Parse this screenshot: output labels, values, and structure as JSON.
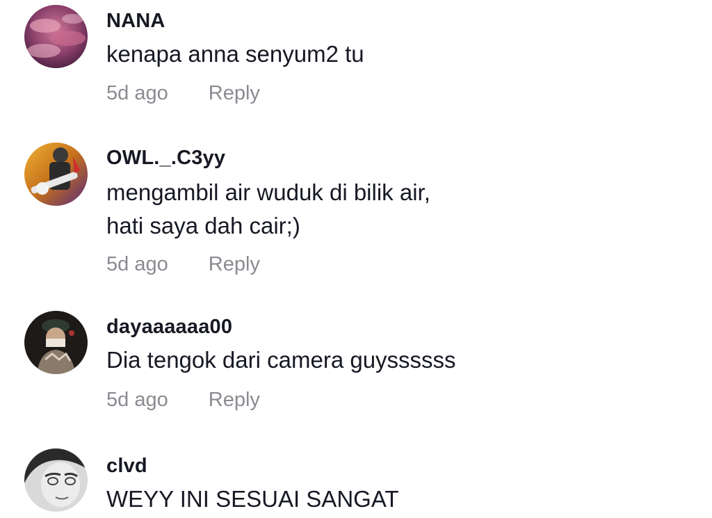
{
  "comments": [
    {
      "username": "NANA",
      "text_lines": [
        "kenapa anna senyum2 tu"
      ],
      "time": "5d ago",
      "reply_label": "Reply",
      "avatar_icon": "avatar-clouds-icon"
    },
    {
      "username": "OWL._.C3yy",
      "text_lines": [
        "mengambil air wuduk di bilik air,",
        "hati saya dah cair;)"
      ],
      "time": "5d ago",
      "reply_label": "Reply",
      "avatar_icon": "avatar-guitarist-icon"
    },
    {
      "username": "dayaaaaaa00",
      "text_lines": [
        "Dia tengok dari camera guyssssss"
      ],
      "time": "5d ago",
      "reply_label": "Reply",
      "avatar_icon": "avatar-masked-person-icon"
    },
    {
      "username": "clvd",
      "text_lines": [
        "WEYY INI SESUAI SANGAT"
      ],
      "time": "",
      "reply_label": "",
      "avatar_icon": "avatar-portrait-icon"
    }
  ],
  "colors": {
    "username": "#161823",
    "text": "#161823",
    "meta": "#8a8b91"
  }
}
